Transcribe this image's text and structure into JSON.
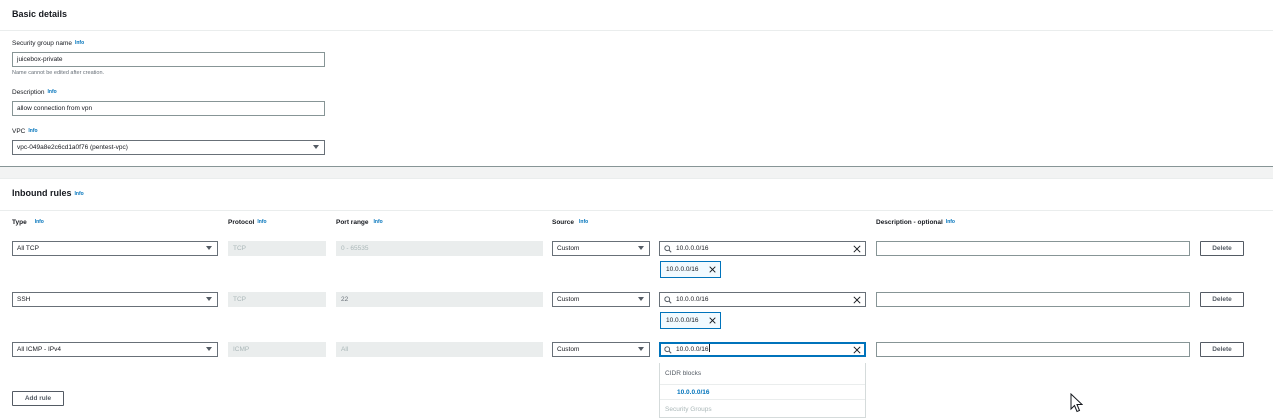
{
  "basic": {
    "title": "Basic details",
    "sg_name_label": "Security group name",
    "info": "Info",
    "sg_name_value": "juicebox-private",
    "sg_name_hint": "Name cannot be edited after creation.",
    "desc_label": "Description",
    "desc_value": "allow connection from vpn",
    "vpc_label": "VPC",
    "vpc_value": "vpc-049a8e2c6cd1a0f76 (pentest-vpc)"
  },
  "inbound": {
    "title": "Inbound rules",
    "info": "Info",
    "columns": {
      "type": "Type",
      "protocol": "Protocol",
      "port_range": "Port range",
      "source": "Source",
      "description": "Description - optional"
    },
    "rules": [
      {
        "type": "All TCP",
        "protocol": "TCP",
        "port": "0 - 65535",
        "source": "Custom",
        "search": "10.0.0.0/16",
        "token": "10.0.0.0/16",
        "description": "",
        "delete": "Delete"
      },
      {
        "type": "SSH",
        "protocol": "TCP",
        "port": "22",
        "source": "Custom",
        "search": "10.0.0.0/16",
        "token": "10.0.0.0/16",
        "description": "",
        "delete": "Delete"
      },
      {
        "type": "All ICMP - IPv4",
        "protocol": "ICMP",
        "port": "All",
        "source": "Custom",
        "search": "10.0.0.0/16",
        "description": "",
        "delete": "Delete"
      }
    ],
    "add_rule": "Add rule",
    "dropdown": {
      "group_cidr": "CIDR blocks",
      "option_cidr": "10.0.0.0/16",
      "group_sg": "Security Groups"
    }
  }
}
